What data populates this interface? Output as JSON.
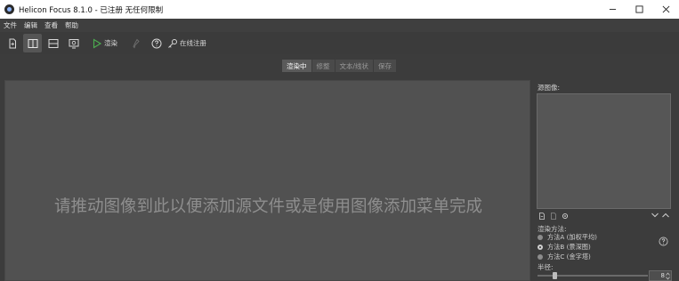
{
  "window": {
    "title": "Helicon Focus 8.1.0 - 已注册  无任何限制"
  },
  "menu": {
    "items": [
      "文件",
      "编辑",
      "查看",
      "帮助"
    ]
  },
  "toolbar": {
    "render_label": "渲染",
    "register_label": "在线注册",
    "icons": [
      "new-file-icon",
      "split-vertical-icon",
      "split-horizontal-icon",
      "screen-icon",
      "play-icon",
      "brush-icon",
      "help-icon",
      "key-icon"
    ],
    "render_color": "#4caf50"
  },
  "tabs": [
    {
      "label": "渲染中",
      "active": true
    },
    {
      "label": "修整",
      "active": false
    },
    {
      "label": "文本/线状",
      "active": false
    },
    {
      "label": "保存",
      "active": false
    }
  ],
  "canvas": {
    "hint": "请推动图像到此以便添加源文件或是使用图像添加菜单完成"
  },
  "panel": {
    "source_title": "源图像:",
    "method_title": "渲染方法:",
    "methods": [
      {
        "label": "方法A (加权平均)",
        "selected": false
      },
      {
        "label": "方法B (景深图)",
        "selected": true
      },
      {
        "label": "方法C (金字塔)",
        "selected": false
      }
    ],
    "radius_title": "半径:",
    "radius_value": "8",
    "radius_fraction": 0.16
  }
}
